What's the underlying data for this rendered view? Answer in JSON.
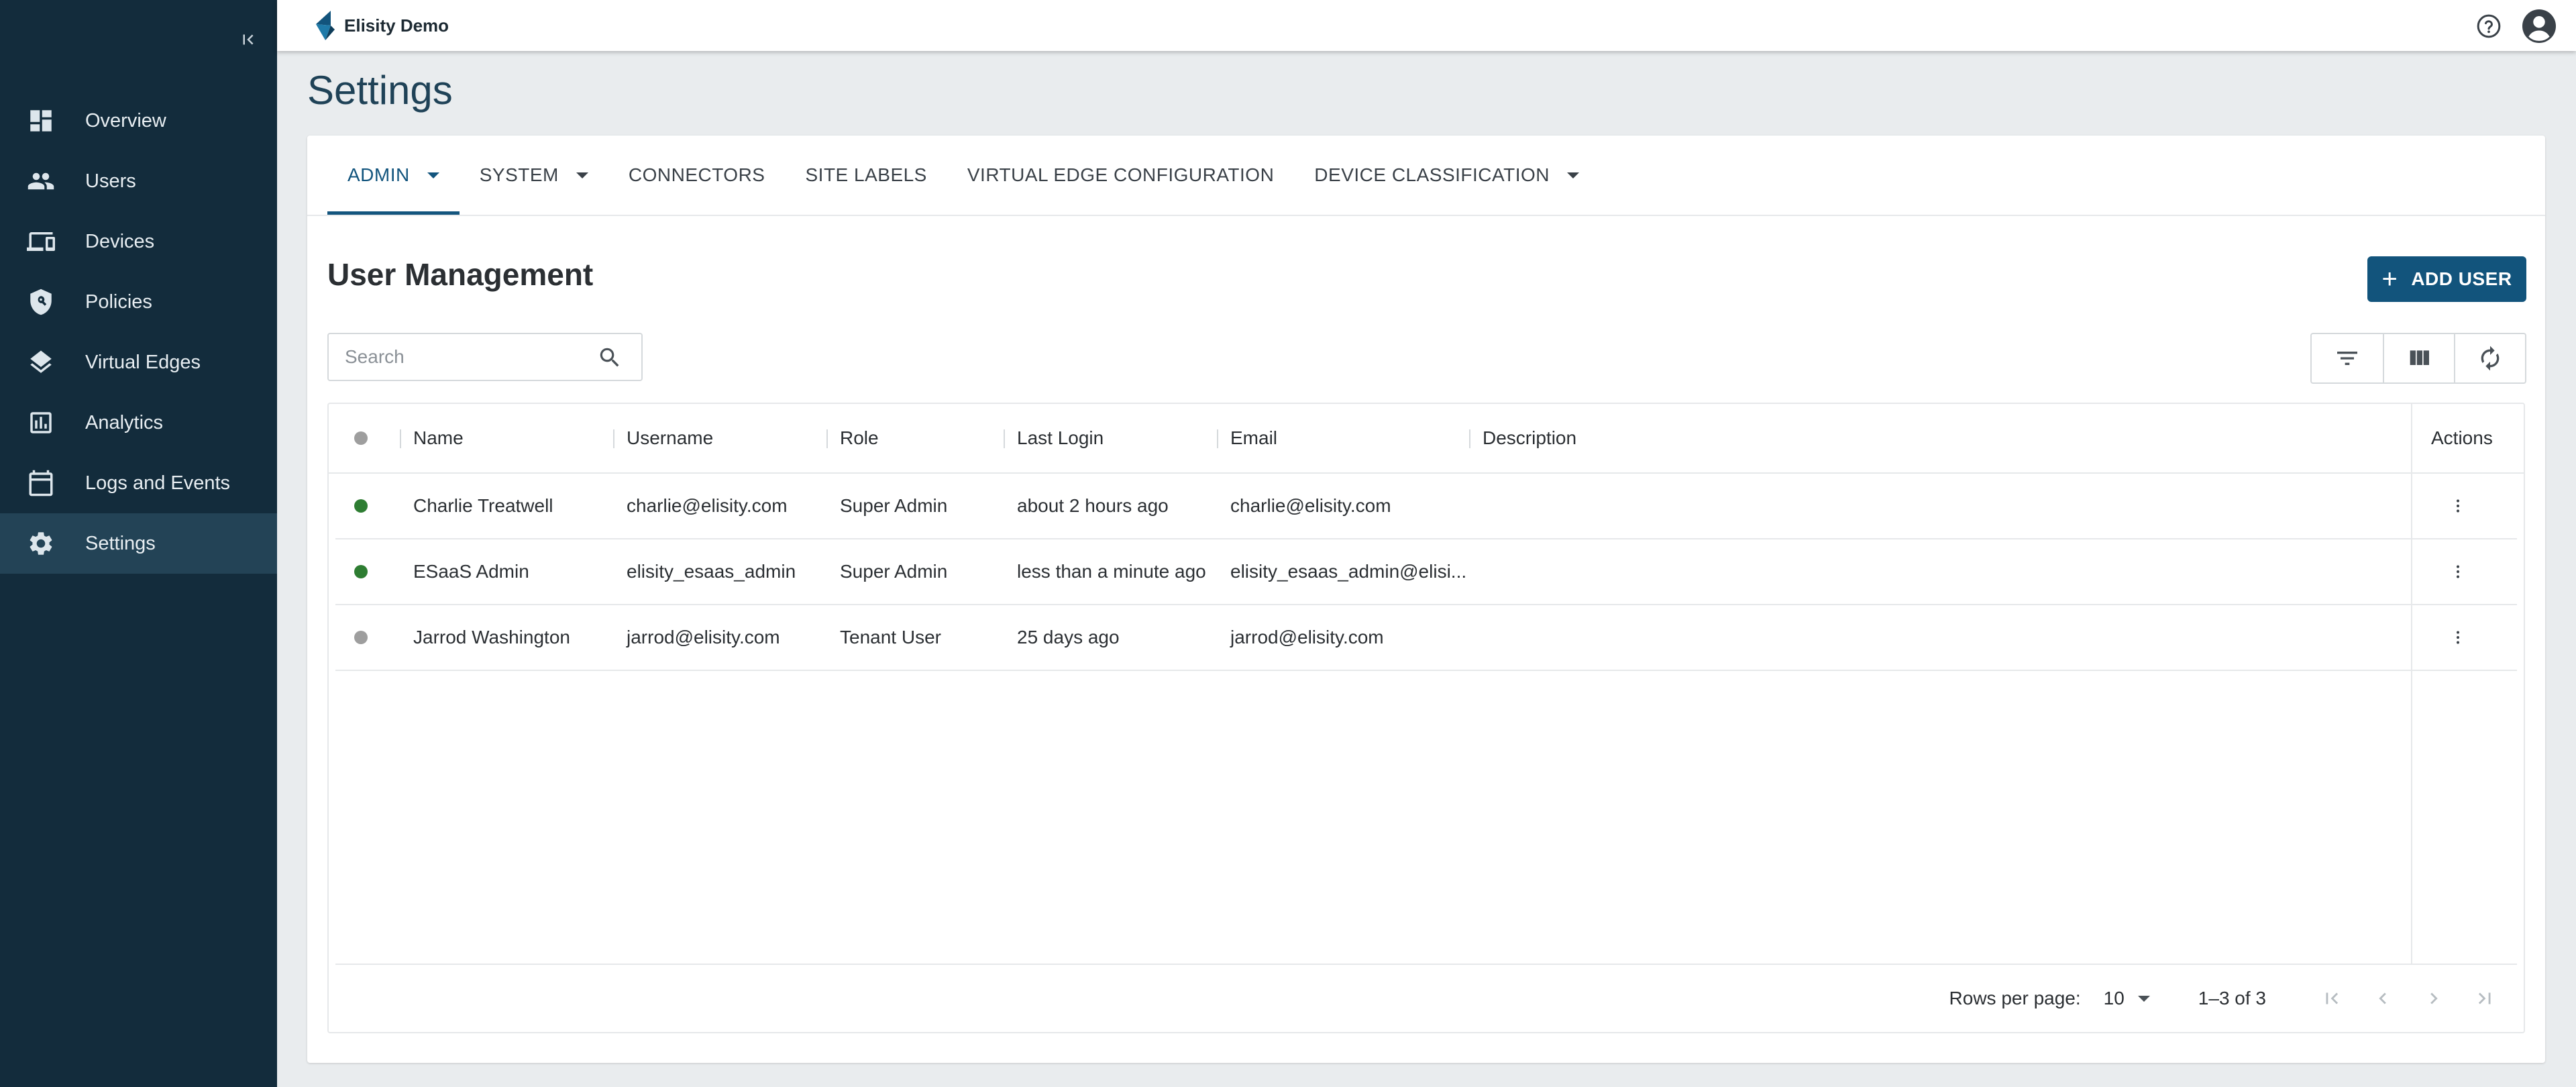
{
  "app": {
    "brand": "Elisity Demo"
  },
  "sidebar": {
    "collapse_label": "⇤",
    "items": [
      {
        "label": "Overview",
        "icon": "dashboard-icon"
      },
      {
        "label": "Users",
        "icon": "users-icon"
      },
      {
        "label": "Devices",
        "icon": "devices-icon"
      },
      {
        "label": "Policies",
        "icon": "policy-shield-icon"
      },
      {
        "label": "Virtual Edges",
        "icon": "layers-icon"
      },
      {
        "label": "Analytics",
        "icon": "analytics-icon"
      },
      {
        "label": "Logs and Events",
        "icon": "calendar-icon"
      },
      {
        "label": "Settings",
        "icon": "gear-icon",
        "active": true
      }
    ]
  },
  "page": {
    "title": "Settings"
  },
  "tabs": [
    {
      "label": "ADMIN",
      "dropdown": true,
      "active": true
    },
    {
      "label": "SYSTEM",
      "dropdown": true
    },
    {
      "label": "CONNECTORS"
    },
    {
      "label": "SITE LABELS"
    },
    {
      "label": "VIRTUAL EDGE CONFIGURATION"
    },
    {
      "label": "DEVICE CLASSIFICATION",
      "dropdown": true
    }
  ],
  "section": {
    "title": "User Management",
    "add_button": "ADD USER",
    "search_placeholder": "Search"
  },
  "table": {
    "columns": [
      "Name",
      "Username",
      "Role",
      "Last Login",
      "Email",
      "Description",
      "Actions"
    ],
    "rows": [
      {
        "status": "active",
        "name": "Charlie Treatwell",
        "username": "charlie@elisity.com",
        "role": "Super Admin",
        "last_login": "about 2 hours ago",
        "email": "charlie@elisity.com",
        "description": ""
      },
      {
        "status": "active",
        "name": "ESaaS Admin",
        "username": "elisity_esaas_admin",
        "role": "Super Admin",
        "last_login": "less than a minute ago",
        "email": "elisity_esaas_admin@elisi...",
        "description": ""
      },
      {
        "status": "inactive",
        "name": "Jarrod Washington",
        "username": "jarrod@elisity.com",
        "role": "Tenant User",
        "last_login": "25 days ago",
        "email": "jarrod@elisity.com",
        "description": ""
      }
    ]
  },
  "pagination": {
    "rows_label": "Rows per page:",
    "rows_value": "10",
    "range": "1–3 of 3"
  },
  "colors": {
    "sidebar": "#132c3c",
    "accent": "#12547c",
    "active_dot": "#2e7d32",
    "inactive_dot": "#9e9e9e"
  }
}
